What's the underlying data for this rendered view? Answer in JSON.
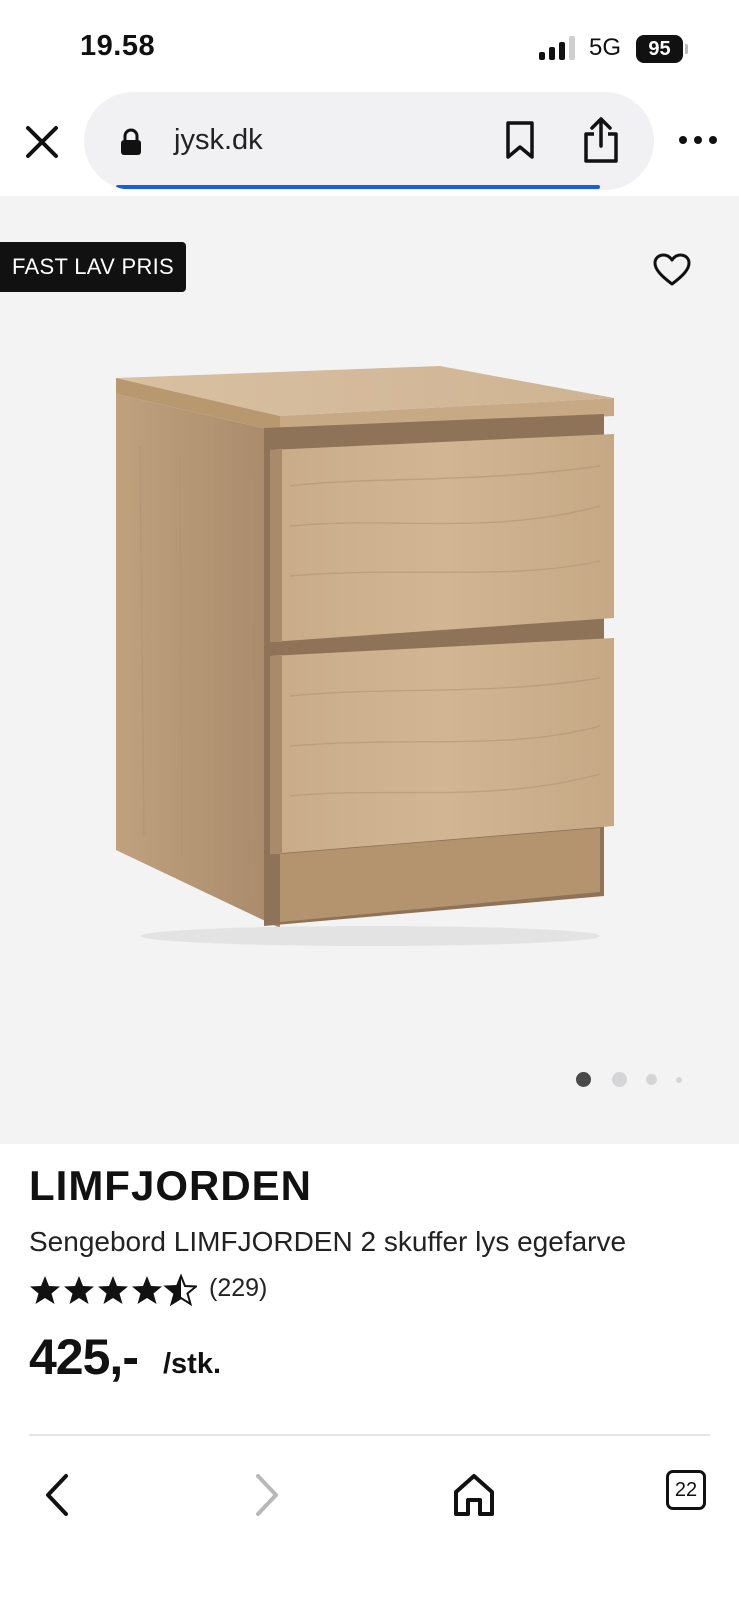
{
  "status_bar": {
    "time": "19.58",
    "network": "5G",
    "battery": "95"
  },
  "browser": {
    "url": "jysk.dk",
    "icons": [
      "close-icon",
      "lock-icon",
      "bookmark-icon",
      "share-icon",
      "more-icon"
    ]
  },
  "product_gallery": {
    "badge": "FAST LAV PRIS",
    "image_count": 4,
    "active_image": 1
  },
  "product": {
    "brand": "LIMFJORDEN",
    "description": "Sengebord LIMFJORDEN 2 skuffer lys egefarve",
    "rating": 4.5,
    "rating_count": "(229)",
    "price": "425,-",
    "price_unit": "/stk."
  },
  "toolbar": {
    "tabs_count": "22",
    "icons": [
      "back-icon",
      "forward-icon",
      "home-icon",
      "tabs-icon"
    ]
  },
  "colors": {
    "accent": "#1a5fd6",
    "badge_bg": "#111111",
    "image_bg": "#f3f3f4"
  }
}
